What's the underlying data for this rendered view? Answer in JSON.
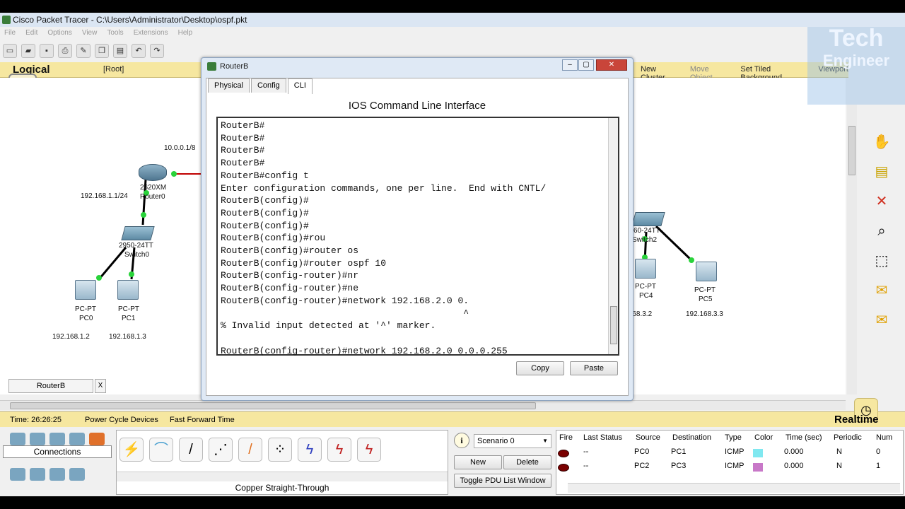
{
  "window": {
    "title": "Cisco Packet Tracer - C:\\Users\\Administrator\\Desktop\\ospf.pkt"
  },
  "menu": [
    "File",
    "Edit",
    "Options",
    "View",
    "Tools",
    "Extensions",
    "Help"
  ],
  "workspace_bar": {
    "mode": "Logical",
    "root": "[Root]",
    "new_cluster": "New Cluster",
    "move_object": "Move Object",
    "set_tiled_background": "Set Tiled Background",
    "viewport": "Viewport"
  },
  "topology": {
    "router0": {
      "model": "2620XM",
      "name": "Router0",
      "ip_link": "10.0.0.1/8",
      "ip_lan": "192.168.1.1/24"
    },
    "switch0": {
      "model": "2950-24TT",
      "name": "Switch0"
    },
    "pc0": {
      "type": "PC-PT",
      "name": "PC0",
      "ip": "192.168.1.2"
    },
    "pc1": {
      "type": "PC-PT",
      "name": "PC1",
      "ip": "192.168.1.3"
    },
    "switch2": {
      "model": "60-24TT",
      "name": "Switch2"
    },
    "pc4": {
      "type": "PC-PT",
      "name": "PC4",
      "ip": ".168.3.2"
    },
    "pc5": {
      "type": "PC-PT",
      "name": "PC5",
      "ip": "192.168.3.3"
    }
  },
  "device_tab": {
    "label": "RouterB",
    "close": "X"
  },
  "dialog": {
    "title": "RouterB",
    "tabs": [
      "Physical",
      "Config",
      "CLI"
    ],
    "active_tab": "CLI",
    "heading": "IOS Command Line Interface",
    "terminal_lines": [
      "RouterB#",
      "RouterB#",
      "RouterB#",
      "RouterB#",
      "RouterB#config t",
      "Enter configuration commands, one per line.  End with CNTL/",
      "RouterB(config)#",
      "RouterB(config)#",
      "RouterB(config)#",
      "RouterB(config)#rou",
      "RouterB(config)#router os",
      "RouterB(config)#router ospf 10",
      "RouterB(config-router)#nr",
      "RouterB(config-router)#ne",
      "RouterB(config-router)#network 192.168.2.0 0.",
      "                                            ^",
      "% Invalid input detected at '^' marker.",
      "",
      "RouterB(config-router)#network 192.168.2.0 0.0.0.255"
    ],
    "copy_label": "Copy",
    "paste_label": "Paste"
  },
  "status": {
    "time": "Time: 26:26:25",
    "power_cycle": "Power Cycle Devices",
    "fast_forward": "Fast Forward Time",
    "realtime": "Realtime"
  },
  "connections": {
    "label": "Connections",
    "selected_type": "Copper Straight-Through"
  },
  "scenario": {
    "info": "i",
    "selected": "Scenario 0",
    "new": "New",
    "delete": "Delete",
    "toggle": "Toggle PDU List Window"
  },
  "pdu_table": {
    "headers": [
      "Fire",
      "Last Status",
      "Source",
      "Destination",
      "Type",
      "Color",
      "Time (sec)",
      "Periodic",
      "Num"
    ],
    "rows": [
      {
        "last_status": "--",
        "source": "PC0",
        "destination": "PC1",
        "type": "ICMP",
        "color": "#80e8f0",
        "time": "0.000",
        "periodic": "N",
        "num": "0"
      },
      {
        "last_status": "--",
        "source": "PC2",
        "destination": "PC3",
        "type": "ICMP",
        "color": "#c878c8",
        "time": "0.000",
        "periodic": "N",
        "num": "1"
      }
    ]
  },
  "watermark": {
    "line1": "Tech",
    "line2": "Engineer"
  }
}
